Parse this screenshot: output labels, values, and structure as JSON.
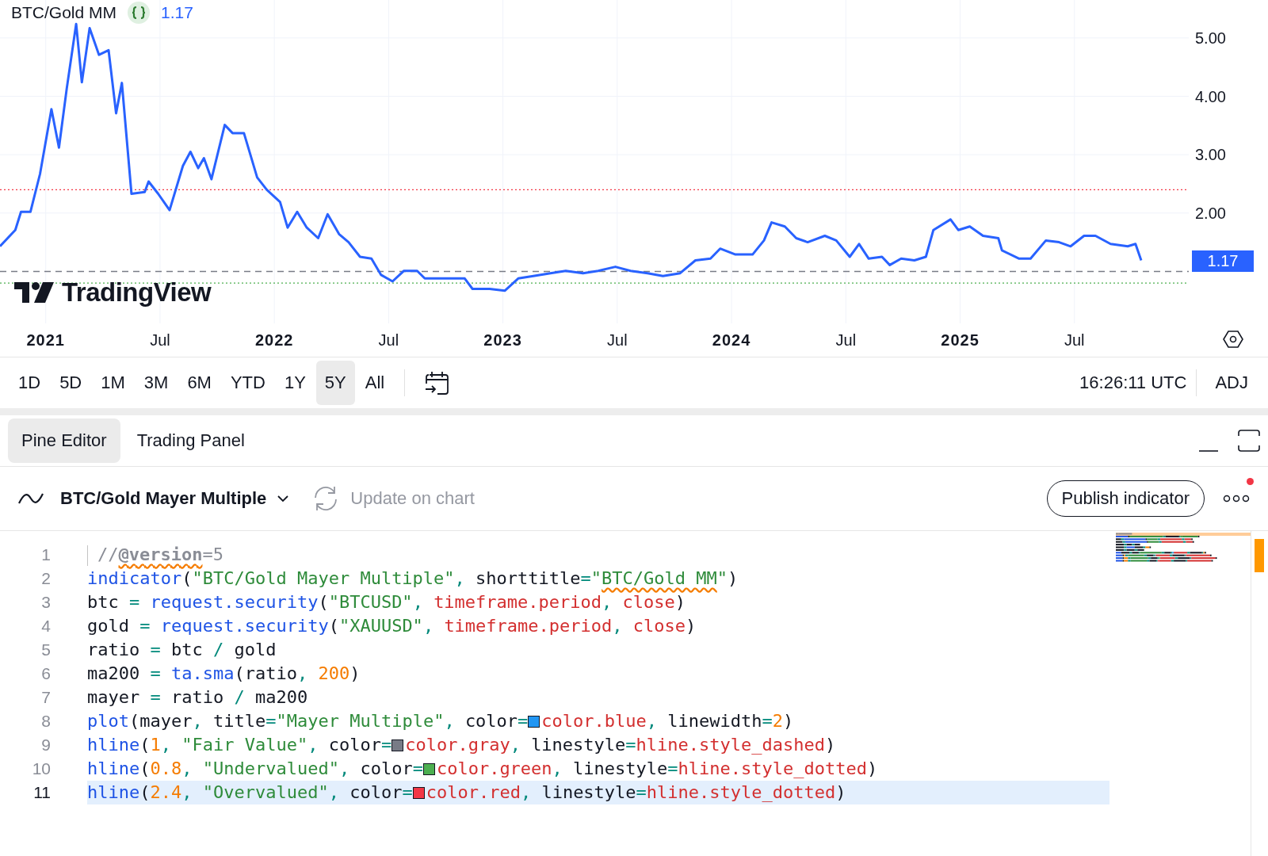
{
  "chart": {
    "legend": {
      "value": "1.17"
    },
    "watermark": {
      "text": "TradingView"
    },
    "price_label": "1.17",
    "chart_data": {
      "type": "line",
      "x": [
        2020.8,
        2020.867,
        2020.892,
        2020.933,
        2020.975,
        2021.025,
        2021.058,
        2021.092,
        2021.133,
        2021.158,
        2021.192,
        2021.233,
        2021.275,
        2021.308,
        2021.333,
        2021.375,
        2021.433,
        2021.45,
        2021.492,
        2021.542,
        2021.6,
        2021.633,
        2021.667,
        2021.692,
        2021.725,
        2021.783,
        2021.817,
        2021.867,
        2021.925,
        2021.967,
        2022.025,
        2022.058,
        2022.1,
        2022.142,
        2022.192,
        2022.233,
        2022.283,
        2022.325,
        2022.375,
        2022.425,
        2022.467,
        2022.517,
        2022.567,
        2022.625,
        2022.658,
        2022.708,
        2022.783,
        2022.833,
        2022.867,
        2022.942,
        2023.008,
        2023.067,
        2023.133,
        2023.208,
        2023.275,
        2023.35,
        2023.417,
        2023.492,
        2023.558,
        2023.633,
        2023.7,
        2023.775,
        2023.842,
        2023.908,
        2023.95,
        2024.017,
        2024.092,
        2024.142,
        2024.175,
        2024.233,
        2024.283,
        2024.333,
        2024.408,
        2024.458,
        2024.517,
        2024.558,
        2024.6,
        2024.658,
        2024.692,
        2024.742,
        2024.8,
        2024.85,
        2024.883,
        2024.958,
        2024.992,
        2025.042,
        2025.1,
        2025.167,
        2025.183,
        2025.258,
        2025.308,
        2025.375,
        2025.433,
        2025.483,
        2025.542,
        2025.592,
        2025.658,
        2025.733,
        2025.767,
        2025.792
      ],
      "series": [
        {
          "name": "BTC/Gold MM",
          "color": "#2962ff",
          "values": [
            1.43,
            1.71,
            2.02,
            2.02,
            2.67,
            3.78,
            3.12,
            4.13,
            5.24,
            4.24,
            5.17,
            4.71,
            4.79,
            3.71,
            4.23,
            2.33,
            2.36,
            2.54,
            2.33,
            2.05,
            2.81,
            3.05,
            2.77,
            2.94,
            2.58,
            3.51,
            3.37,
            3.37,
            2.61,
            2.4,
            2.19,
            1.75,
            2.02,
            1.75,
            1.57,
            1.98,
            1.64,
            1.5,
            1.25,
            1.22,
            0.94,
            0.83,
            1.01,
            1.01,
            0.88,
            0.88,
            0.88,
            0.88,
            0.7,
            0.7,
            0.67,
            0.88,
            0.92,
            0.97,
            1.01,
            0.97,
            1.01,
            1.08,
            1.01,
            0.97,
            0.92,
            0.97,
            1.19,
            1.22,
            1.39,
            1.29,
            1.29,
            1.53,
            1.84,
            1.77,
            1.57,
            1.5,
            1.61,
            1.53,
            1.25,
            1.47,
            1.22,
            1.25,
            1.11,
            1.22,
            1.19,
            1.25,
            1.71,
            1.89,
            1.71,
            1.77,
            1.61,
            1.57,
            1.36,
            1.22,
            1.22,
            1.53,
            1.5,
            1.43,
            1.61,
            1.61,
            1.47,
            1.43,
            1.47,
            1.19
          ]
        }
      ],
      "xlim": [
        2020.8,
        2026.0
      ],
      "ylim": [
        0.11,
        5.65
      ],
      "xticks": [
        2021,
        {
          "value": 2021.5,
          "label": "Jul"
        },
        2022,
        {
          "value": 2022.5,
          "label": "Jul"
        },
        2023,
        {
          "value": 2023.5,
          "label": "Jul"
        },
        2024,
        {
          "value": 2024.5,
          "label": "Jul"
        },
        2025,
        {
          "value": 2025.5,
          "label": "Jul"
        }
      ],
      "yticks": [
        {
          "value": 2,
          "label": "2.00"
        },
        {
          "value": 3,
          "label": "3.00"
        },
        {
          "value": 4,
          "label": "4.00"
        },
        {
          "value": 5,
          "label": "5.00"
        }
      ],
      "grid": true,
      "ref_lines": [
        {
          "axis": "y",
          "value": 2.4,
          "color": "#f23645"
        },
        {
          "axis": "y",
          "value": 1,
          "color": "#787b86"
        },
        {
          "axis": "y",
          "value": 0.8,
          "color": "#4caf50"
        }
      ]
    }
  },
  "toolbar": {
    "ranges": [
      {
        "label": "1D",
        "selected": false
      },
      {
        "label": "5D",
        "selected": false
      },
      {
        "label": "1M",
        "selected": false
      },
      {
        "label": "3M",
        "selected": false
      },
      {
        "label": "6M",
        "selected": false
      },
      {
        "label": "YTD",
        "selected": false
      },
      {
        "label": "1Y",
        "selected": false
      },
      {
        "label": "5Y",
        "selected": true
      },
      {
        "label": "All",
        "selected": false
      }
    ],
    "time": "16:26:11 UTC",
    "adjust": "ADJ"
  },
  "panel_tabs": [
    {
      "label": "Pine Editor",
      "selected": true
    },
    {
      "label": "Trading Panel",
      "selected": false
    }
  ],
  "editor": {
    "script_title": "BTC/Gold Mayer Multiple",
    "update_button": {
      "label": "Update on chart",
      "disabled": true
    },
    "publish_button": "Publish indicator",
    "has_notification": true,
    "lines": [
      {
        "number": "1",
        "current": false,
        "tokens": [
          {
            "kind": "comment",
            "t": "//"
          },
          {
            "kind": "annotation",
            "t": "@version",
            "warning": true
          },
          {
            "kind": "comment",
            "t": "=5"
          }
        ]
      },
      {
        "number": "2",
        "current": false,
        "tokens": [
          {
            "kind": "func",
            "t": "indicator"
          },
          {
            "kind": "plain",
            "t": "("
          },
          {
            "kind": "str",
            "t": "\"BTC/Gold Mayer Multiple\""
          },
          {
            "kind": "op",
            "t": ", "
          },
          {
            "kind": "plain",
            "t": "shorttitle"
          },
          {
            "kind": "op",
            "t": "="
          },
          {
            "kind": "str",
            "t": "\""
          },
          {
            "kind": "str",
            "t": "BTC/Gold MM",
            "warning": true
          },
          {
            "kind": "str",
            "t": "\""
          },
          {
            "kind": "plain",
            "t": ")"
          }
        ]
      },
      {
        "number": "3",
        "current": false,
        "tokens": [
          {
            "kind": "plain",
            "t": "btc "
          },
          {
            "kind": "op",
            "t": "= "
          },
          {
            "kind": "func",
            "t": "request.security"
          },
          {
            "kind": "plain",
            "t": "("
          },
          {
            "kind": "str",
            "t": "\"BTCUSD\""
          },
          {
            "kind": "op",
            "t": ", "
          },
          {
            "kind": "var",
            "t": "timeframe.period"
          },
          {
            "kind": "op",
            "t": ", "
          },
          {
            "kind": "var",
            "t": "close"
          },
          {
            "kind": "plain",
            "t": ")"
          }
        ]
      },
      {
        "number": "4",
        "current": false,
        "tokens": [
          {
            "kind": "plain",
            "t": "gold "
          },
          {
            "kind": "op",
            "t": "= "
          },
          {
            "kind": "func",
            "t": "request.security"
          },
          {
            "kind": "plain",
            "t": "("
          },
          {
            "kind": "str",
            "t": "\"XAUUSD\""
          },
          {
            "kind": "op",
            "t": ", "
          },
          {
            "kind": "var",
            "t": "timeframe.period"
          },
          {
            "kind": "op",
            "t": ", "
          },
          {
            "kind": "var",
            "t": "close"
          },
          {
            "kind": "plain",
            "t": ")"
          }
        ]
      },
      {
        "number": "5",
        "current": false,
        "tokens": [
          {
            "kind": "plain",
            "t": "ratio "
          },
          {
            "kind": "op",
            "t": "= "
          },
          {
            "kind": "plain",
            "t": "btc "
          },
          {
            "kind": "op",
            "t": "/ "
          },
          {
            "kind": "plain",
            "t": "gold"
          }
        ]
      },
      {
        "number": "6",
        "current": false,
        "tokens": [
          {
            "kind": "plain",
            "t": "ma200 "
          },
          {
            "kind": "op",
            "t": "= "
          },
          {
            "kind": "func",
            "t": "ta.sma"
          },
          {
            "kind": "plain",
            "t": "(ratio"
          },
          {
            "kind": "op",
            "t": ", "
          },
          {
            "kind": "num",
            "t": "200"
          },
          {
            "kind": "plain",
            "t": ")"
          }
        ]
      },
      {
        "number": "7",
        "current": false,
        "tokens": [
          {
            "kind": "plain",
            "t": "mayer "
          },
          {
            "kind": "op",
            "t": "= "
          },
          {
            "kind": "plain",
            "t": "ratio "
          },
          {
            "kind": "op",
            "t": "/ "
          },
          {
            "kind": "plain",
            "t": "ma200"
          }
        ]
      },
      {
        "number": "8",
        "current": false,
        "tokens": [
          {
            "kind": "func",
            "t": "plot"
          },
          {
            "kind": "plain",
            "t": "(mayer"
          },
          {
            "kind": "op",
            "t": ", "
          },
          {
            "kind": "plain",
            "t": "title"
          },
          {
            "kind": "op",
            "t": "="
          },
          {
            "kind": "str",
            "t": "\"Mayer Multiple\""
          },
          {
            "kind": "op",
            "t": ", "
          },
          {
            "kind": "plain",
            "t": "color"
          },
          {
            "kind": "op",
            "t": "="
          },
          {
            "kind": "swatch",
            "color": "#2196f3"
          },
          {
            "kind": "var",
            "t": "color.blue"
          },
          {
            "kind": "op",
            "t": ", "
          },
          {
            "kind": "plain",
            "t": "linewidth"
          },
          {
            "kind": "op",
            "t": "="
          },
          {
            "kind": "num",
            "t": "2"
          },
          {
            "kind": "plain",
            "t": ")"
          }
        ]
      },
      {
        "number": "9",
        "current": false,
        "tokens": [
          {
            "kind": "func",
            "t": "hline"
          },
          {
            "kind": "plain",
            "t": "("
          },
          {
            "kind": "num",
            "t": "1"
          },
          {
            "kind": "op",
            "t": ", "
          },
          {
            "kind": "str",
            "t": "\"Fair Value\""
          },
          {
            "kind": "op",
            "t": ", "
          },
          {
            "kind": "plain",
            "t": "color"
          },
          {
            "kind": "op",
            "t": "="
          },
          {
            "kind": "swatch",
            "color": "#787b86"
          },
          {
            "kind": "var",
            "t": "color.gray"
          },
          {
            "kind": "op",
            "t": ", "
          },
          {
            "kind": "plain",
            "t": "linestyle"
          },
          {
            "kind": "op",
            "t": "="
          },
          {
            "kind": "var",
            "t": "hline.style_dashed"
          },
          {
            "kind": "plain",
            "t": ")"
          }
        ]
      },
      {
        "number": "10",
        "current": false,
        "tokens": [
          {
            "kind": "func",
            "t": "hline"
          },
          {
            "kind": "plain",
            "t": "("
          },
          {
            "kind": "num",
            "t": "0.8"
          },
          {
            "kind": "op",
            "t": ", "
          },
          {
            "kind": "str",
            "t": "\"Undervalued\""
          },
          {
            "kind": "op",
            "t": ", "
          },
          {
            "kind": "plain",
            "t": "color"
          },
          {
            "kind": "op",
            "t": "="
          },
          {
            "kind": "swatch",
            "color": "#4caf50"
          },
          {
            "kind": "var",
            "t": "color.green"
          },
          {
            "kind": "op",
            "t": ", "
          },
          {
            "kind": "plain",
            "t": "linestyle"
          },
          {
            "kind": "op",
            "t": "="
          },
          {
            "kind": "var",
            "t": "hline.style_dotted"
          },
          {
            "kind": "plain",
            "t": ")"
          }
        ]
      },
      {
        "number": "11",
        "current": true,
        "tokens": [
          {
            "kind": "func",
            "t": "hline"
          },
          {
            "kind": "plain",
            "t": "("
          },
          {
            "kind": "num",
            "t": "2.4"
          },
          {
            "kind": "op",
            "t": ", "
          },
          {
            "kind": "str",
            "t": "\"Overvalued\""
          },
          {
            "kind": "op",
            "t": ", "
          },
          {
            "kind": "plain",
            "t": "color"
          },
          {
            "kind": "op",
            "t": "="
          },
          {
            "kind": "swatch",
            "color": "#f23645"
          },
          {
            "kind": "var",
            "t": "color.red"
          },
          {
            "kind": "op",
            "t": ", "
          },
          {
            "kind": "plain",
            "t": "linestyle"
          },
          {
            "kind": "op",
            "t": "="
          },
          {
            "kind": "var",
            "t": "hline.style_dotted"
          },
          {
            "kind": "plain",
            "t": ")"
          }
        ]
      }
    ]
  }
}
